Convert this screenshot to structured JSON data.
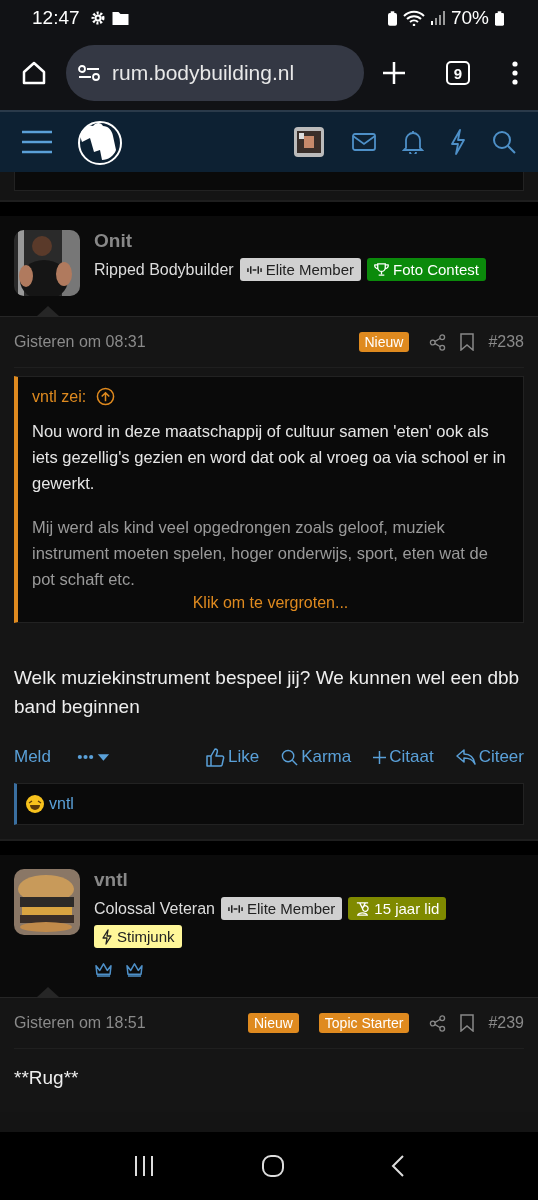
{
  "status_bar": {
    "time": "12:47",
    "battery": "70%"
  },
  "browser": {
    "url": "rum.bodybuilding.nl",
    "tab_count": "9"
  },
  "posts": [
    {
      "author": "Onit",
      "rank": "Ripped Bodybuilder",
      "badges": [
        {
          "kind": "dumbbell",
          "label": "Elite Member",
          "color": "#d0d0d0"
        },
        {
          "kind": "trophy",
          "label": "Foto Contest",
          "color": "#0b8a0b"
        }
      ],
      "date": "Gisteren om 08:31",
      "tags": [
        "Nieuw"
      ],
      "number": "#238",
      "quote": {
        "author": "vntl zei:",
        "paragraphs": [
          "Nou word in deze maatschappij of cultuur samen 'eten' ook als iets gezellig's gezien en word dat ook al vroeg oa via school er in gewerkt.",
          "Mij werd als kind veel opgedrongen zoals geloof, muziek instrument moeten spelen, hoger onderwijs, sport, eten wat de pot schaft etc."
        ],
        "expand": "Klik om te vergroten..."
      },
      "body": "Welk muziekinstrument bespeel jij? We kunnen wel een dbb band beginnen",
      "actions": {
        "report": "Meld",
        "like": "Like",
        "karma": "Karma",
        "add_quote": "Citaat",
        "reply": "Citeer"
      },
      "reactions": [
        {
          "user": "vntl"
        }
      ]
    },
    {
      "author": "vntl",
      "rank": "Colossal Veteran",
      "badges": [
        {
          "kind": "dumbbell",
          "label": "Elite Member",
          "color": "#d0d0d0"
        },
        {
          "kind": "medal",
          "label": "15 jaar lid",
          "color": "#7f8a00"
        },
        {
          "kind": "bolt",
          "label": "Stimjunk",
          "color": "#fff799"
        }
      ],
      "trophy_icons": [
        {
          "kind": "crown"
        },
        {
          "kind": "crown"
        }
      ],
      "date": "Gisteren om 18:51",
      "tags": [
        "Nieuw",
        "Topic Starter"
      ],
      "number": "#239",
      "body": "**Rug**"
    }
  ]
}
